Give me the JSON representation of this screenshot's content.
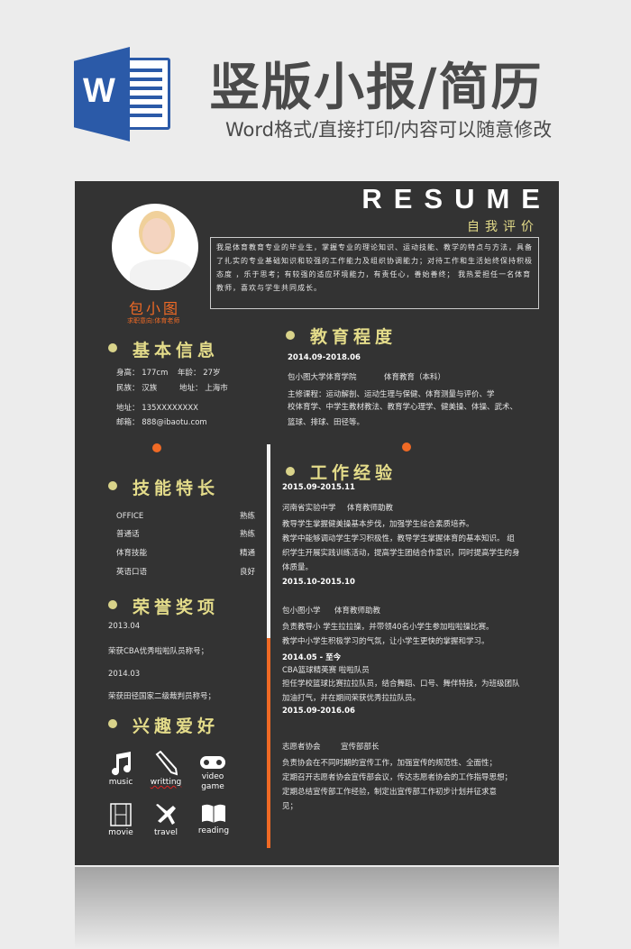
{
  "header": {
    "title": "竖版小报/简历",
    "subtitle": "Word格式/直接打印/内容可以随意修改",
    "logo_letter": "W"
  },
  "resume": {
    "title": "RESUME",
    "name": "包小图",
    "intent": "求职意向:体育老师",
    "self_eval": {
      "heading": "自我评价",
      "text": "我是体育教育专业的毕业生，掌握专业的理论知识、运动技能、教学的特点与方法，具备了扎实的专业基础知识和较强的工作能力及组织协调能力；对待工作和生活始终保持积极态度 ，乐于思考；有较强的适应环境能力，有责任心，善始善终； 我热爱担任一名体育教师，喜欢与学生共同成长。"
    },
    "basic": {
      "heading": "基本信息",
      "height": "身高： 177cm",
      "age": "年龄： 27岁",
      "ethnicity": "民族： 汉族",
      "location": "地址： 上海市",
      "phone": "地址： 135XXXXXXXX",
      "email": "邮箱： 888@ibaotu.com"
    },
    "skills": {
      "heading": "技能特长",
      "items": [
        {
          "name": "OFFICE",
          "level": "熟练"
        },
        {
          "name": "普通话",
          "level": "熟练"
        },
        {
          "name": "体育技能",
          "level": "精通"
        },
        {
          "name": "英语口语",
          "level": "良好"
        }
      ]
    },
    "honors": {
      "heading": "荣誉奖项",
      "items": [
        {
          "date": "2013.04",
          "text": "荣获CBA优秀啦啦队员称号；"
        },
        {
          "date": "2014.03",
          "text": "荣获田径国家二级裁判员称号；"
        }
      ]
    },
    "hobbies": {
      "heading": "兴趣爱好",
      "items": [
        {
          "label": "music",
          "icon": "music-icon"
        },
        {
          "label": "writting",
          "icon": "pencil-icon"
        },
        {
          "label": "video game",
          "icon": "gamepad-icon"
        },
        {
          "label": "movie",
          "icon": "film-icon"
        },
        {
          "label": "travel",
          "icon": "airplane-icon"
        },
        {
          "label": "reading",
          "icon": "book-icon"
        }
      ]
    },
    "education": {
      "heading": "教育程度",
      "date": "2014.09-2018.06",
      "school": "包小图大学体育学院",
      "major": "体育教育（本科）",
      "courses": [
        "主修课程：运动解剖、运动生理与保健、体育测量与评价、学",
        "校体育学、中学生教材教法、教育学心理学、健美操、体操、武术、",
        "篮球、排球、田径等。"
      ]
    },
    "work": {
      "heading": "工作经验",
      "jobs": [
        {
          "date": "2015.09-2015.11",
          "org": "河南省实验中学",
          "role": "体育教师助教",
          "lines": [
            "教导学生掌握健美操基本步伐，加强学生综合素质培养。",
            "教学中能够调动学生学习积极性，教导学生掌握体育的基本知识。 组",
            "织学生开展实践训练活动，提高学生团结合作意识，同时提高学生的身",
            "体质量。"
          ]
        },
        {
          "date": "2015.10-2015.10",
          "org": "包小图小学",
          "role": "体育教师助教",
          "lines": [
            "负责教导小 学生拉拉操，并带领40名小学生参加啦啦操比赛。",
            "教学中小学生积极学习的气氛，让小学生更快的掌握和学习。"
          ]
        },
        {
          "date": "2014.05 - 至今",
          "org": "CBA篮球精英赛 啦啦队员",
          "role": "",
          "lines": [
            "担任学校篮球比赛拉拉队员，结合舞蹈、口号、舞伴特技，为班级团队",
            "加油打气，并在期间荣获优秀拉拉队员。"
          ]
        },
        {
          "date": "2015.09-2016.06",
          "org": "志愿者协会",
          "role": "宣传部部长",
          "lines": [
            "负责协会在不同时期的宣传工作，加强宣传的规范性、全面性；",
            "定期召开志愿者协会宣传部会议，传达志愿者协会的工作指导思想；",
            "定期总结宣传部工作经验，制定出宣传部工作初步计划并征求意",
            "见；"
          ]
        }
      ]
    },
    "colors": {
      "background": "#333333",
      "accent": "#f06a25",
      "heading": "#e4dc8a"
    }
  }
}
